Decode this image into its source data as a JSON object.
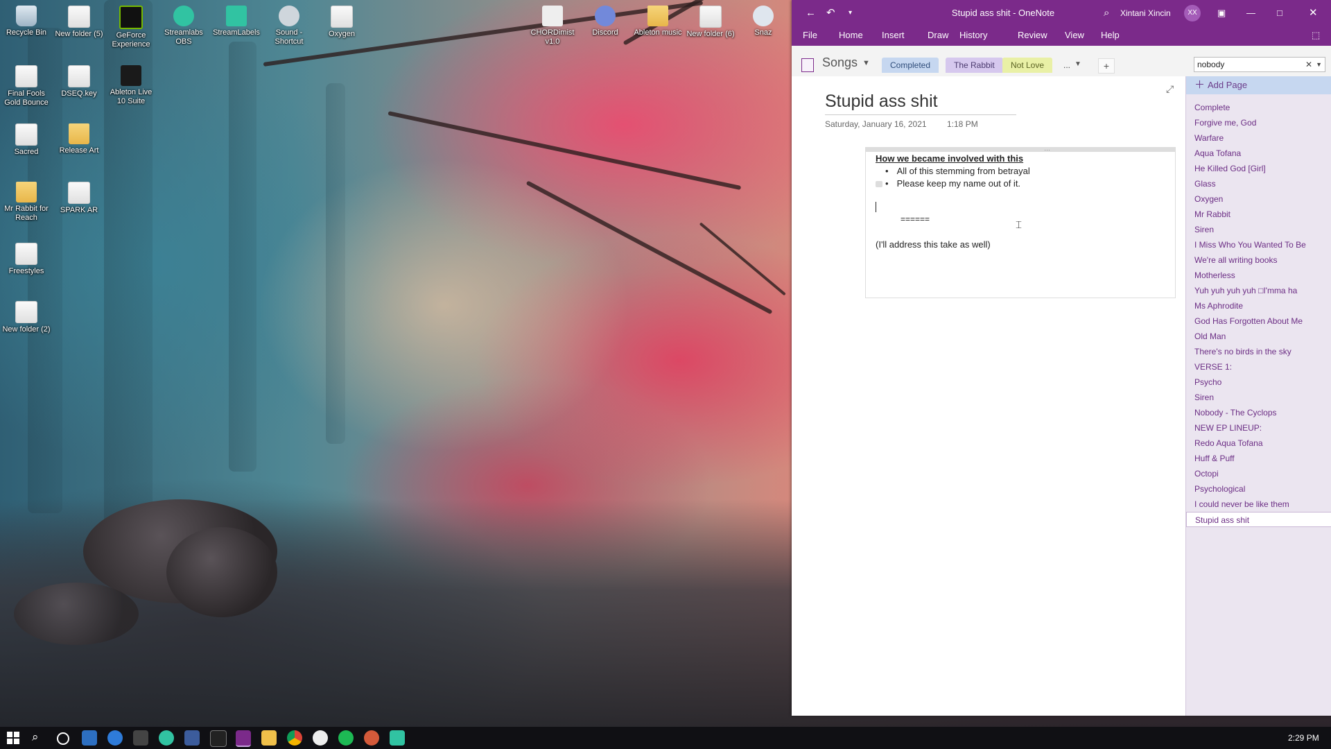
{
  "desktop": {
    "icons": [
      {
        "label": "Recycle Bin",
        "icon": "recycle-bin-icon"
      },
      {
        "label": "New folder (5)",
        "icon": "folder-icon"
      },
      {
        "label": "GeForce Experience",
        "icon": "nvidia-icon"
      },
      {
        "label": "Streamlabs OBS",
        "icon": "streamlabs-icon"
      },
      {
        "label": "StreamLabels",
        "icon": "streamlabels-icon"
      },
      {
        "label": "Sound - Shortcut",
        "icon": "sound-icon"
      },
      {
        "label": "Oxygen",
        "icon": "document-icon"
      },
      {
        "label": "CHORDimist v1.0",
        "icon": "chordimist-icon"
      },
      {
        "label": "Discord",
        "icon": "discord-icon"
      },
      {
        "label": "Ableton music",
        "icon": "folder-icon"
      },
      {
        "label": "New folder (6)",
        "icon": "folder-icon"
      },
      {
        "label": "Snaz",
        "icon": "snaz-icon"
      },
      {
        "label": "Final Fools Gold Bounce",
        "icon": "document-icon"
      },
      {
        "label": "DSEQ.key",
        "icon": "document-icon"
      },
      {
        "label": "Ableton Live 10 Suite",
        "icon": "ableton-icon"
      },
      {
        "label": "Sacred",
        "icon": "document-icon"
      },
      {
        "label": "Release Art",
        "icon": "folder-icon"
      },
      {
        "label": "Mr Rabbit for Reach",
        "icon": "folder-icon"
      },
      {
        "label": "SPARK AR",
        "icon": "document-icon"
      },
      {
        "label": "Freestyles",
        "icon": "document-icon"
      },
      {
        "label": "New folder (2)",
        "icon": "folder-icon"
      }
    ]
  },
  "onenote": {
    "title": "Stupid ass shit - OneNote",
    "user_name": "Xintani Xincin",
    "user_initials": "XX",
    "ribbon_tabs": [
      "File",
      "Home",
      "Insert",
      "Draw",
      "History",
      "Review",
      "View",
      "Help"
    ],
    "notebook": "Songs",
    "section_tabs": [
      {
        "label": "Completed",
        "color": "#c6d7f0"
      },
      {
        "label": "The Rabbit",
        "color": "#d6c8ee"
      },
      {
        "label": "Not Love",
        "color": "#e9f0a6"
      },
      {
        "label": "...",
        "color": "#f3f3f3"
      }
    ],
    "add_section": "+",
    "search_value": "nobody",
    "page": {
      "title": "Stupid ass shit",
      "date": "Saturday, January 16, 2021",
      "time": "1:18 PM",
      "heading": "How we became involved with this",
      "bullets": [
        "All of this stemming from betrayal",
        "Please keep my name out of it."
      ],
      "separator": "======",
      "closing": "(I'll address this take as well)"
    },
    "add_page": "Add Page",
    "pages": [
      "Complete",
      "Forgive me, God",
      "Warfare",
      "Aqua Tofana",
      "He Killed God [Girl]",
      "Glass",
      "Oxygen",
      "Mr Rabbit",
      "Siren",
      "I Miss Who You Wanted To Be",
      "We're all writing books",
      "Motherless",
      "Yuh yuh yuh yuh □I'mma ha",
      "Ms Aphrodite",
      "God Has Forgotten About Me",
      "Old Man",
      "There's no birds in the sky",
      "VERSE 1:",
      "Psycho",
      "Siren",
      "Nobody - The Cyclops",
      "NEW EP LINEUP:",
      "Redo Aqua Tofana",
      "Huff & Puff",
      "Octopi",
      "Psychological",
      "I could never be like them",
      "Stupid ass shit"
    ],
    "selected_page": 27,
    "accent": "#7b2a8a"
  },
  "taskbar": {
    "clock": "2:29 PM"
  }
}
